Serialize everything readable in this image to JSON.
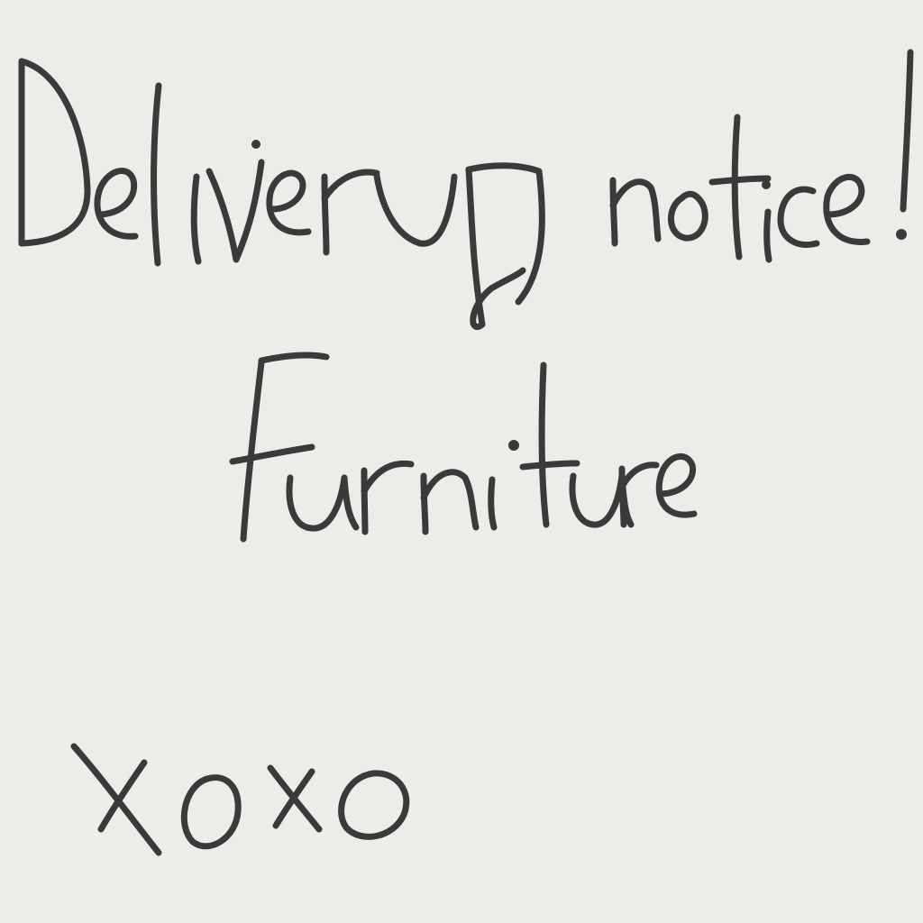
{
  "note": {
    "line1": "Delivery notice!",
    "line2": "Furniture",
    "signoff": "xoxo"
  },
  "colors": {
    "background": "#ecece8",
    "ink": "#3a3a3a"
  }
}
